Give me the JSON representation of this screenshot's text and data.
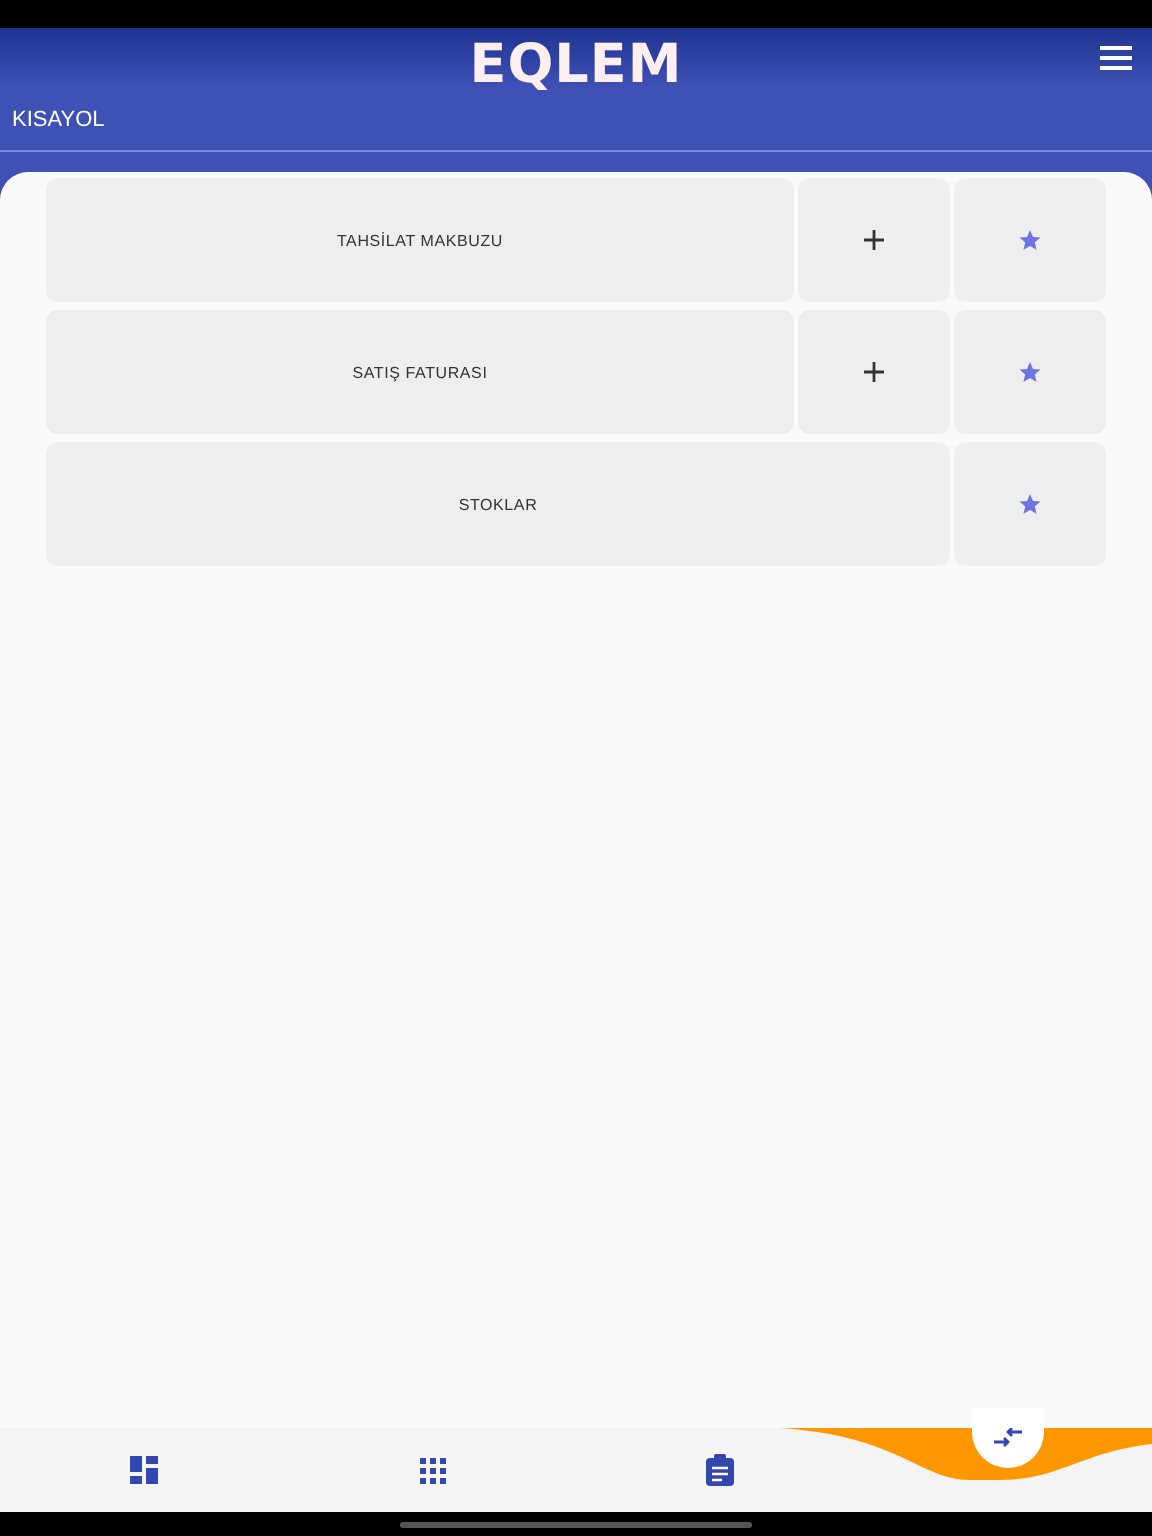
{
  "app": {
    "title": "EQLEM"
  },
  "section": {
    "title": "KISAYOL"
  },
  "shortcuts": [
    {
      "label": "TAHSİLAT MAKBUZU",
      "addable": true,
      "favorite": true
    },
    {
      "label": "SATIŞ FATURASI",
      "addable": true,
      "favorite": true
    },
    {
      "label": "STOKLAR",
      "addable": false,
      "favorite": true
    }
  ]
}
